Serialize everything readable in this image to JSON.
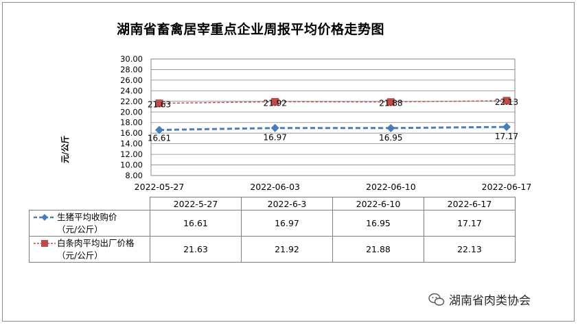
{
  "title": "湖南省畜禽居宰重点企业周报平均价格走势图",
  "watermark": "湖南省肉类协会",
  "chart_data": {
    "type": "line",
    "title": "湖南省畜禽居宰重点企业周报平均价格走势图",
    "ylabel": "元/公斤",
    "xlabel": "",
    "ylim": [
      8.0,
      30.0
    ],
    "ytick_step": 2.0,
    "yticks": [
      "30.00",
      "28.00",
      "26.00",
      "24.00",
      "22.00",
      "20.00",
      "18.00",
      "16.00",
      "14.00",
      "12.00",
      "10.00",
      "8.00"
    ],
    "x": [
      "2022-05-27",
      "2022-06-03",
      "2022-06-10",
      "2022-06-17"
    ],
    "grid": true,
    "series": [
      {
        "name_line1": "生猪平均收购价",
        "name_line2": "（元/公斤）",
        "color": "#4a7ebb",
        "marker": "diamond",
        "values": [
          16.61,
          16.97,
          16.95,
          17.17
        ]
      },
      {
        "name_line1": "白条肉平均出厂价格",
        "name_line2": "（元/公斤）",
        "color": "#be4b48",
        "marker": "square",
        "values": [
          21.63,
          21.92,
          21.88,
          22.13
        ]
      }
    ]
  },
  "table": {
    "headers": [
      "2022-5-27",
      "2022-6-3",
      "2022-6-10",
      "2022-6-17"
    ],
    "rows": [
      [
        "16.61",
        "16.97",
        "16.95",
        "17.17"
      ],
      [
        "21.63",
        "21.92",
        "21.88",
        "22.13"
      ]
    ]
  }
}
